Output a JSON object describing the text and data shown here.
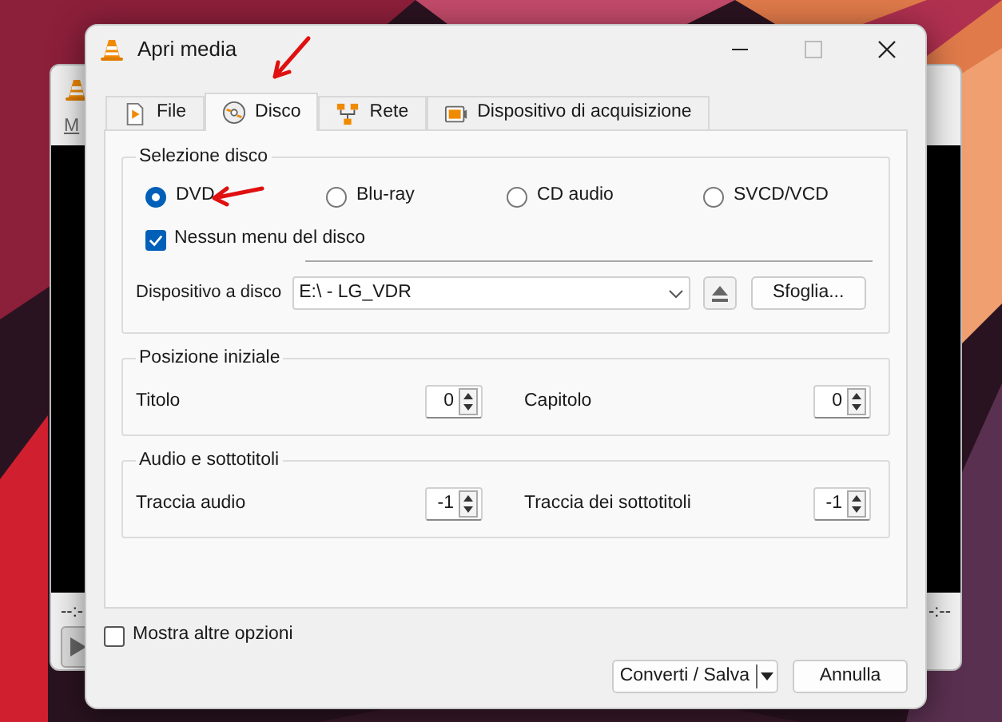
{
  "background_window": {
    "menu": "M",
    "time_left": "--:-",
    "time_right": "-:--"
  },
  "window": {
    "title": "Apri media"
  },
  "tabs": [
    {
      "label": "File",
      "selected": false
    },
    {
      "label": "Disco",
      "selected": true
    },
    {
      "label": "Rete",
      "selected": false
    },
    {
      "label": "Dispositivo di acquisizione",
      "selected": false
    }
  ],
  "disc_selection": {
    "title": "Selezione disco",
    "disc_types": [
      {
        "label": "DVD",
        "selected": true
      },
      {
        "label": "Blu-ray",
        "selected": false
      },
      {
        "label": "CD audio",
        "selected": false
      },
      {
        "label": "SVCD/VCD",
        "selected": false
      }
    ],
    "no_disc_menu": {
      "label": "Nessun menu del disco",
      "checked": true
    },
    "device": {
      "label": "Dispositivo a disco",
      "value": "E:\\ - LG_VDR"
    },
    "browse_button": "Sfoglia..."
  },
  "start_position": {
    "title": "Posizione iniziale",
    "fields": [
      {
        "label": "Titolo",
        "value": "0"
      },
      {
        "label": "Capitolo",
        "value": "0"
      }
    ]
  },
  "audio_subtitles": {
    "title": "Audio e sottotitoli",
    "fields": [
      {
        "label": "Traccia audio",
        "value": "-1"
      },
      {
        "label": "Traccia dei sottotitoli",
        "value": "-1"
      }
    ]
  },
  "show_more_options": {
    "label": "Mostra altre opzioni",
    "checked": false
  },
  "buttons": {
    "convert": "Converti / Salva",
    "cancel": "Annulla"
  }
}
